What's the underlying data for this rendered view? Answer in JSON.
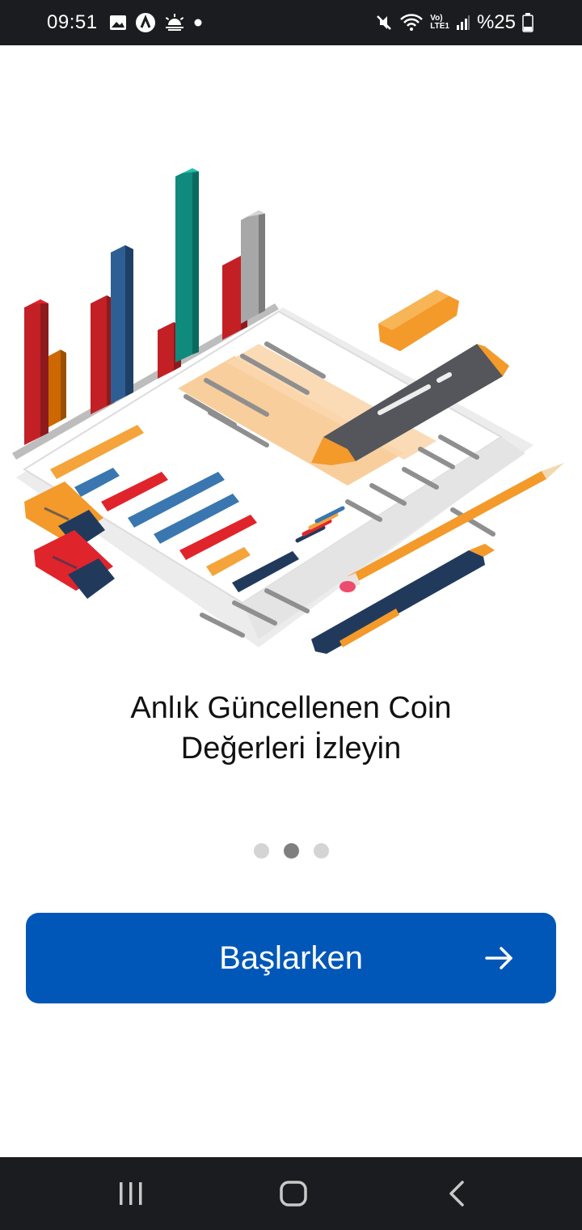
{
  "status_bar": {
    "time": "09:51",
    "left_icons": [
      "image-icon",
      "navigation-app-icon",
      "weather-sunrise-icon",
      "notification-dot-icon"
    ],
    "right_icons": [
      "mute-icon",
      "wifi-icon",
      "volte-lte-icon",
      "signal-icon"
    ],
    "network_label": "LTE1",
    "volte_label": "Vo)",
    "battery_text": "%25"
  },
  "onboarding": {
    "illustration": "financial-charts-illustration",
    "title_line1": "Anlık Güncellenen Coin",
    "title_line2": "Değerleri İzleyin",
    "page_count": 3,
    "active_page": 2
  },
  "start_button": {
    "label": "Başlarken",
    "icon": "arrow-right-icon",
    "color": "#0057b7"
  },
  "nav_bar": {
    "buttons": [
      "recent-apps-icon",
      "home-icon",
      "back-icon"
    ]
  }
}
